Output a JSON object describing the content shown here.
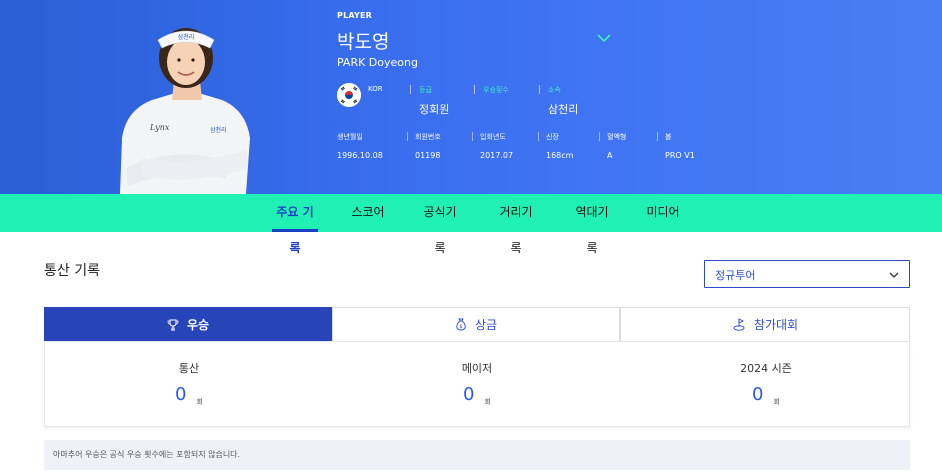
{
  "player": {
    "tag": "PLAYER",
    "name_kr": "박도영",
    "name_en": "PARK Doyeong",
    "nation": "KOR",
    "info": [
      {
        "label": "등급",
        "value": "정회원"
      },
      {
        "label": "우승횟수",
        "value": ""
      },
      {
        "label": "소속",
        "value": "삼천리"
      }
    ],
    "stats": [
      {
        "label": "생년월일",
        "value": "1996.10.08"
      },
      {
        "label": "회원번호",
        "value": "01198"
      },
      {
        "label": "입회년도",
        "value": "2017.07"
      },
      {
        "label": "신장",
        "value": "168cm"
      },
      {
        "label": "혈액형",
        "value": "A"
      },
      {
        "label": "볼",
        "value": "PRO V1"
      }
    ],
    "photo_caption_brands": [
      "Lynx",
      "삼천리"
    ]
  },
  "tabs": [
    "주요 기록",
    "스코어",
    "공식기록",
    "거리기록",
    "역대기록",
    "미디어"
  ],
  "active_tab": 0,
  "section": {
    "title": "통산 기록",
    "tour_select": "정규투어"
  },
  "stat_tabs": [
    {
      "label": "우승",
      "icon": "trophy-icon"
    },
    {
      "label": "상금",
      "icon": "money-bag-icon"
    },
    {
      "label": "참가대회",
      "icon": "golf-flag-icon"
    }
  ],
  "records": [
    {
      "label": "통산",
      "value": "0",
      "unit": "회"
    },
    {
      "label": "메이저",
      "value": "0",
      "unit": "회"
    },
    {
      "label": "2024 시즌",
      "value": "0",
      "unit": "회"
    }
  ],
  "notice": "아마추어 우승은 공식 우승 횟수에는 포함되지 않습니다.",
  "colors": {
    "hero": "#3a6ff0",
    "tab_bar": "#21f0b4",
    "accent": "#2745b8",
    "label_mint": "#3ef0c2"
  }
}
